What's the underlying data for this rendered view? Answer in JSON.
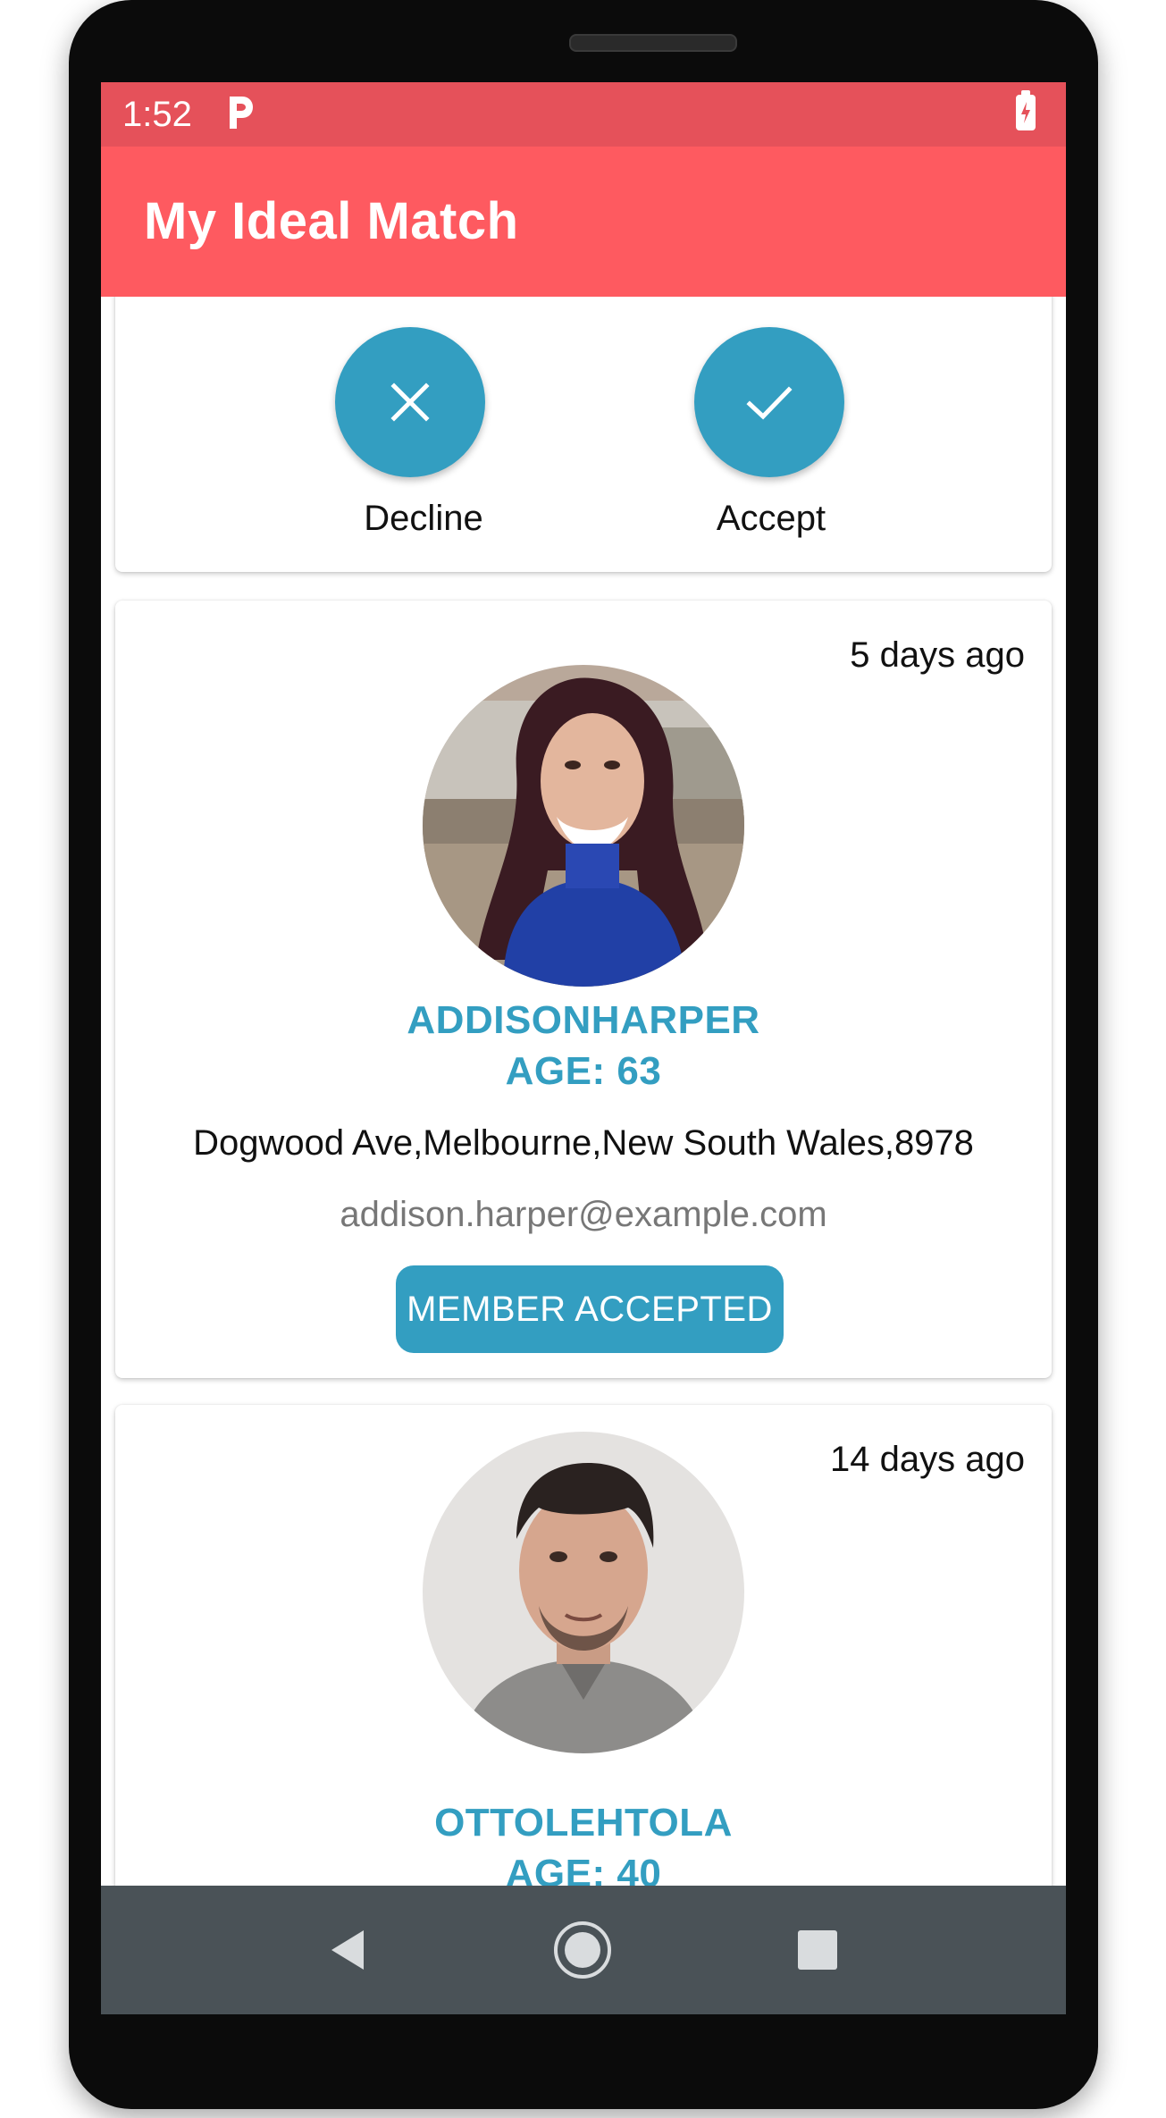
{
  "status_bar": {
    "time": "1:52",
    "indicator_icon": "parking-icon",
    "battery_icon": "battery-charging-icon"
  },
  "app_bar": {
    "title": "My Ideal Match"
  },
  "actions": {
    "decline_label": "Decline",
    "accept_label": "Accept",
    "decline_icon": "close-icon",
    "accept_icon": "check-icon"
  },
  "members": [
    {
      "time_ago": "5 days ago",
      "name": "ADDISONHARPER",
      "age": "AGE: 63",
      "address": "Dogwood Ave,Melbourne,New South Wales,8978",
      "email": "addison.harper@example.com",
      "status_button": "MEMBER ACCEPTED"
    },
    {
      "time_ago": "14 days ago",
      "name": "OTTOLEHTOLA",
      "age": "AGE: 40"
    }
  ],
  "nav_bar": {
    "back_icon": "back-triangle-icon",
    "home_icon": "home-circle-icon",
    "recents_icon": "recents-square-icon"
  },
  "colors": {
    "status_bar": "#e5515a",
    "app_bar": "#fe5a60",
    "accent": "#339ec1",
    "nav_bar": "#4a5257"
  }
}
